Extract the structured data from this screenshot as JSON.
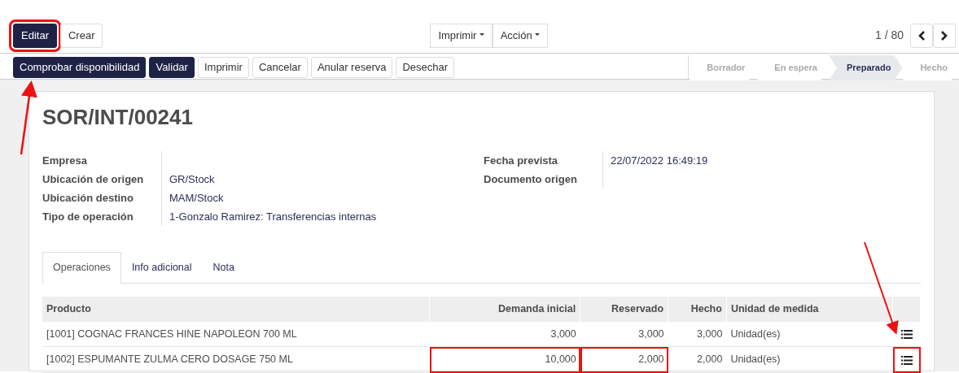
{
  "main_buttons": [
    {
      "label": "Editar",
      "primary": true,
      "highlighted": true
    },
    {
      "label": "Crear",
      "primary": false,
      "highlighted": false
    }
  ],
  "dropdowns": [
    "Imprimir",
    "Acción"
  ],
  "pager": {
    "text": "1 / 80"
  },
  "action_buttons": [
    {
      "label": "Comprobar disponibilidad",
      "primary": true
    },
    {
      "label": "Validar",
      "primary": true
    },
    {
      "label": "Imprimir",
      "primary": false
    },
    {
      "label": "Cancelar",
      "primary": false
    },
    {
      "label": "Anular reserva",
      "primary": false
    },
    {
      "label": "Desechar",
      "primary": false
    }
  ],
  "status_steps": [
    {
      "label": "Borrador",
      "selected": false
    },
    {
      "label": "En espera",
      "selected": false
    },
    {
      "label": "Preparado",
      "selected": true
    },
    {
      "label": "Hecho",
      "selected": false
    }
  ],
  "title": "SOR/INT/00241",
  "left_fields": [
    {
      "label": "Empresa"
    },
    {
      "label": "Ubicación de origen",
      "value": "GR/Stock"
    },
    {
      "label": "Ubicación destino",
      "value": "MAM/Stock"
    },
    {
      "label": "Tipo de operación",
      "value": "1-Gonzalo Ramirez: Transferencias internas"
    }
  ],
  "right_fields": [
    {
      "label": "Fecha prevista",
      "value": "22/07/2022 16:49:19"
    },
    {
      "label": "Documento origen"
    }
  ],
  "tabs": [
    {
      "label": "Operaciones",
      "selected": true
    },
    {
      "label": "Info adicional",
      "selected": false
    },
    {
      "label": "Nota",
      "selected": false
    }
  ],
  "table": {
    "columns": [
      "Producto",
      "Demanda inicial",
      "Reservado",
      "Hecho",
      "Unidad de medida"
    ],
    "rows": [
      {
        "producto": "[1001] COGNAC FRANCES HINE NAPOLEON 700 ML",
        "demanda": "3,000",
        "reservado": "3,000",
        "hecho": "3,000",
        "unidad": "Unidad(es)",
        "highlighted": false
      },
      {
        "producto": "[1002] ESPUMANTE ZULMA CERO DOSAGE 750 ML",
        "demanda": "10,000",
        "reservado": "2,000",
        "hecho": "2,000",
        "unidad": "Unidad(es)",
        "highlighted": true
      }
    ]
  }
}
